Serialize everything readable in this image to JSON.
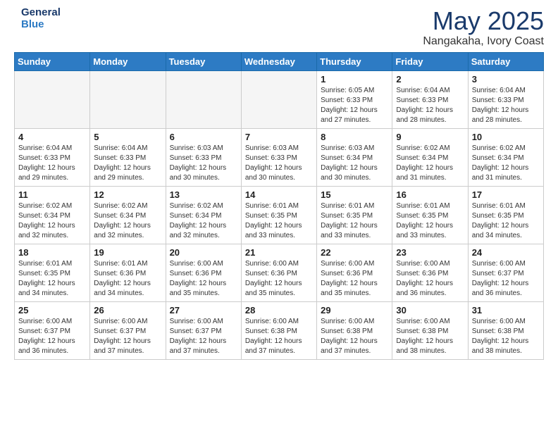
{
  "header": {
    "logo_general": "General",
    "logo_blue": "Blue",
    "month": "May 2025",
    "location": "Nangakaha, Ivory Coast"
  },
  "weekdays": [
    "Sunday",
    "Monday",
    "Tuesday",
    "Wednesday",
    "Thursday",
    "Friday",
    "Saturday"
  ],
  "weeks": [
    [
      {
        "day": "",
        "info": ""
      },
      {
        "day": "",
        "info": ""
      },
      {
        "day": "",
        "info": ""
      },
      {
        "day": "",
        "info": ""
      },
      {
        "day": "1",
        "info": "Sunrise: 6:05 AM\nSunset: 6:33 PM\nDaylight: 12 hours\nand 27 minutes."
      },
      {
        "day": "2",
        "info": "Sunrise: 6:04 AM\nSunset: 6:33 PM\nDaylight: 12 hours\nand 28 minutes."
      },
      {
        "day": "3",
        "info": "Sunrise: 6:04 AM\nSunset: 6:33 PM\nDaylight: 12 hours\nand 28 minutes."
      }
    ],
    [
      {
        "day": "4",
        "info": "Sunrise: 6:04 AM\nSunset: 6:33 PM\nDaylight: 12 hours\nand 29 minutes."
      },
      {
        "day": "5",
        "info": "Sunrise: 6:04 AM\nSunset: 6:33 PM\nDaylight: 12 hours\nand 29 minutes."
      },
      {
        "day": "6",
        "info": "Sunrise: 6:03 AM\nSunset: 6:33 PM\nDaylight: 12 hours\nand 30 minutes."
      },
      {
        "day": "7",
        "info": "Sunrise: 6:03 AM\nSunset: 6:33 PM\nDaylight: 12 hours\nand 30 minutes."
      },
      {
        "day": "8",
        "info": "Sunrise: 6:03 AM\nSunset: 6:34 PM\nDaylight: 12 hours\nand 30 minutes."
      },
      {
        "day": "9",
        "info": "Sunrise: 6:02 AM\nSunset: 6:34 PM\nDaylight: 12 hours\nand 31 minutes."
      },
      {
        "day": "10",
        "info": "Sunrise: 6:02 AM\nSunset: 6:34 PM\nDaylight: 12 hours\nand 31 minutes."
      }
    ],
    [
      {
        "day": "11",
        "info": "Sunrise: 6:02 AM\nSunset: 6:34 PM\nDaylight: 12 hours\nand 32 minutes."
      },
      {
        "day": "12",
        "info": "Sunrise: 6:02 AM\nSunset: 6:34 PM\nDaylight: 12 hours\nand 32 minutes."
      },
      {
        "day": "13",
        "info": "Sunrise: 6:02 AM\nSunset: 6:34 PM\nDaylight: 12 hours\nand 32 minutes."
      },
      {
        "day": "14",
        "info": "Sunrise: 6:01 AM\nSunset: 6:35 PM\nDaylight: 12 hours\nand 33 minutes."
      },
      {
        "day": "15",
        "info": "Sunrise: 6:01 AM\nSunset: 6:35 PM\nDaylight: 12 hours\nand 33 minutes."
      },
      {
        "day": "16",
        "info": "Sunrise: 6:01 AM\nSunset: 6:35 PM\nDaylight: 12 hours\nand 33 minutes."
      },
      {
        "day": "17",
        "info": "Sunrise: 6:01 AM\nSunset: 6:35 PM\nDaylight: 12 hours\nand 34 minutes."
      }
    ],
    [
      {
        "day": "18",
        "info": "Sunrise: 6:01 AM\nSunset: 6:35 PM\nDaylight: 12 hours\nand 34 minutes."
      },
      {
        "day": "19",
        "info": "Sunrise: 6:01 AM\nSunset: 6:36 PM\nDaylight: 12 hours\nand 34 minutes."
      },
      {
        "day": "20",
        "info": "Sunrise: 6:00 AM\nSunset: 6:36 PM\nDaylight: 12 hours\nand 35 minutes."
      },
      {
        "day": "21",
        "info": "Sunrise: 6:00 AM\nSunset: 6:36 PM\nDaylight: 12 hours\nand 35 minutes."
      },
      {
        "day": "22",
        "info": "Sunrise: 6:00 AM\nSunset: 6:36 PM\nDaylight: 12 hours\nand 35 minutes."
      },
      {
        "day": "23",
        "info": "Sunrise: 6:00 AM\nSunset: 6:36 PM\nDaylight: 12 hours\nand 36 minutes."
      },
      {
        "day": "24",
        "info": "Sunrise: 6:00 AM\nSunset: 6:37 PM\nDaylight: 12 hours\nand 36 minutes."
      }
    ],
    [
      {
        "day": "25",
        "info": "Sunrise: 6:00 AM\nSunset: 6:37 PM\nDaylight: 12 hours\nand 36 minutes."
      },
      {
        "day": "26",
        "info": "Sunrise: 6:00 AM\nSunset: 6:37 PM\nDaylight: 12 hours\nand 37 minutes."
      },
      {
        "day": "27",
        "info": "Sunrise: 6:00 AM\nSunset: 6:37 PM\nDaylight: 12 hours\nand 37 minutes."
      },
      {
        "day": "28",
        "info": "Sunrise: 6:00 AM\nSunset: 6:38 PM\nDaylight: 12 hours\nand 37 minutes."
      },
      {
        "day": "29",
        "info": "Sunrise: 6:00 AM\nSunset: 6:38 PM\nDaylight: 12 hours\nand 37 minutes."
      },
      {
        "day": "30",
        "info": "Sunrise: 6:00 AM\nSunset: 6:38 PM\nDaylight: 12 hours\nand 38 minutes."
      },
      {
        "day": "31",
        "info": "Sunrise: 6:00 AM\nSunset: 6:38 PM\nDaylight: 12 hours\nand 38 minutes."
      }
    ]
  ]
}
